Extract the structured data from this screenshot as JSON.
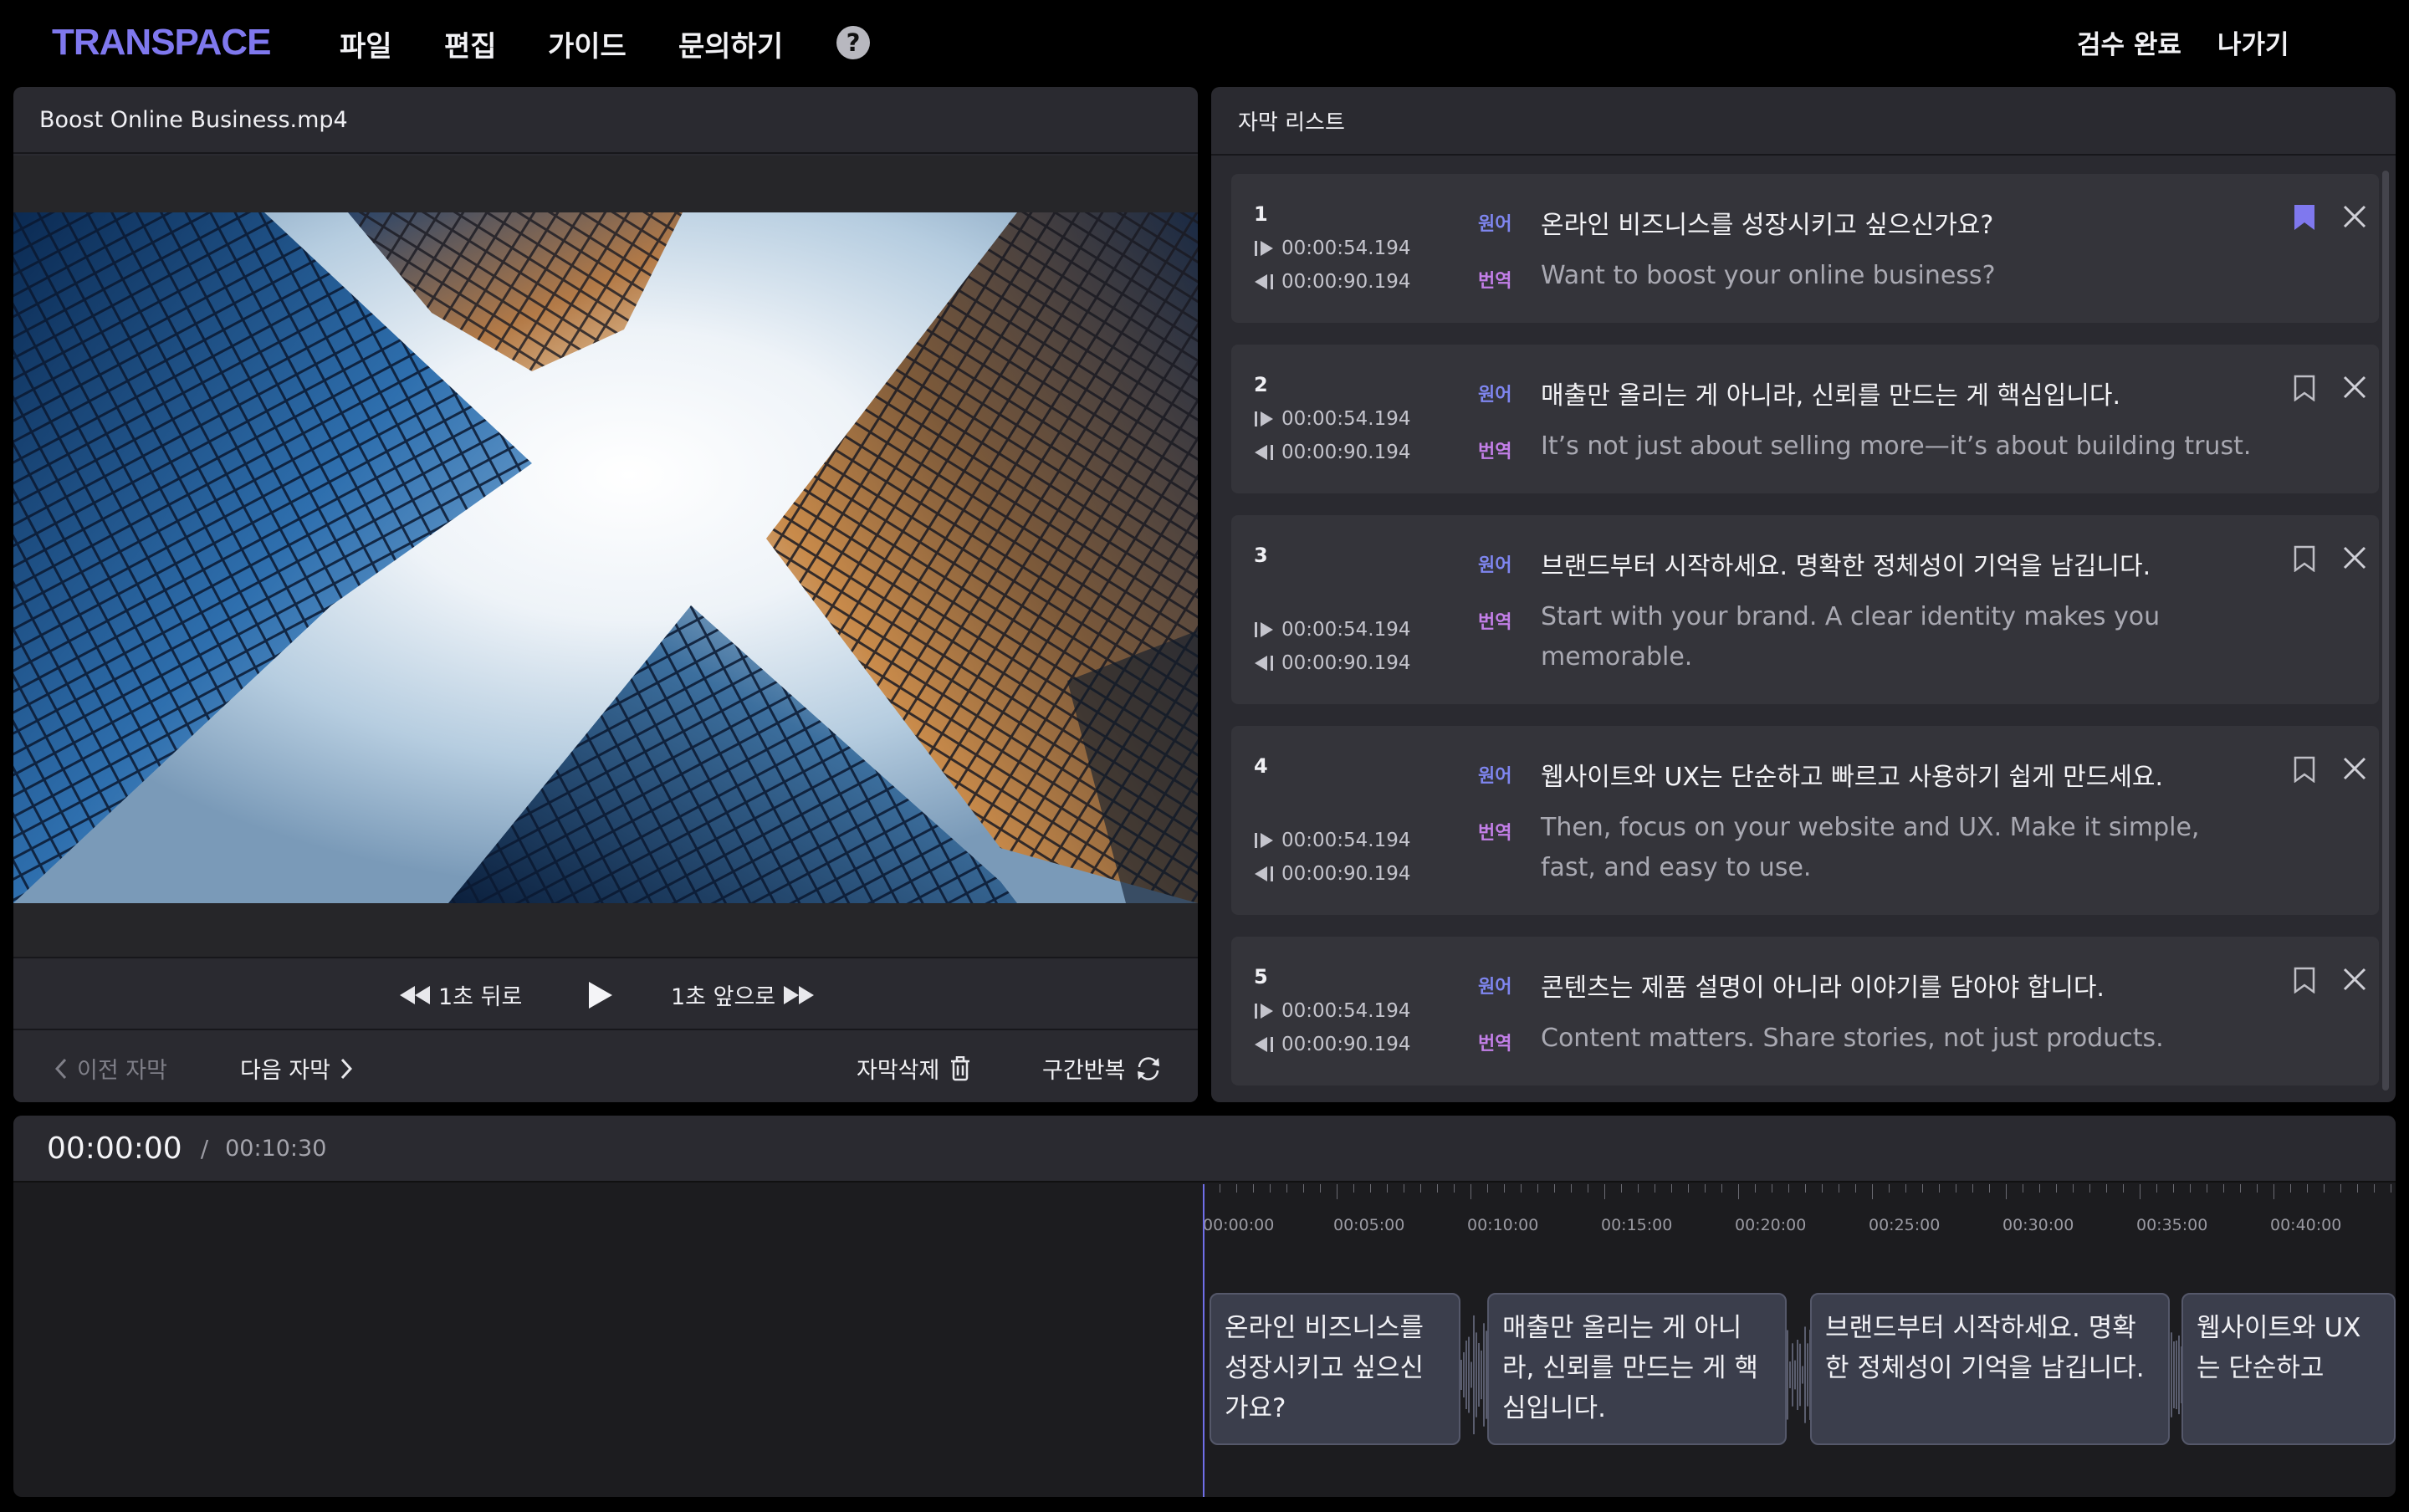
{
  "app": {
    "logo": "TRANSPACE",
    "menu": [
      "파일",
      "편집",
      "가이드",
      "문의하기"
    ],
    "help_glyph": "?",
    "review_done": "검수 완료",
    "exit": "나가기",
    "accent_color": "#7f78ee"
  },
  "video": {
    "filename": "Boost Online Business.mp4",
    "back_label": "1초 뒤로",
    "forward_label": "1초 앞으로",
    "prev_subtitle": "이전 자막",
    "next_subtitle": "다음 자막",
    "delete_subtitle": "자막삭제",
    "loop_section": "구간반복"
  },
  "subtitle_list": {
    "title": "자막 리스트",
    "source_tag": "원어",
    "translation_tag": "번역",
    "items": [
      {
        "index": "1",
        "start": "00:00:54.194",
        "end": "00:00:90.194",
        "source": "온라인 비즈니스를 성장시키고 싶으신가요?",
        "translation": "Want to boost your online business?",
        "bookmarked": true
      },
      {
        "index": "2",
        "start": "00:00:54.194",
        "end": "00:00:90.194",
        "source": "매출만 올리는 게 아니라, 신뢰를 만드는 게 핵심입니다.",
        "translation": "It’s not just about selling more—it’s about building trust.",
        "bookmarked": false
      },
      {
        "index": "3",
        "start": "00:00:54.194",
        "end": "00:00:90.194",
        "source": "브랜드부터 시작하세요. 명확한 정체성이 기억을 남깁니다.",
        "translation": "Start with your brand. A clear identity makes you memorable.",
        "bookmarked": false
      },
      {
        "index": "4",
        "start": "00:00:54.194",
        "end": "00:00:90.194",
        "source": "웹사이트와 UX는 단순하고 빠르고 사용하기 쉽게 만드세요.",
        "translation": "Then, focus on your website and UX. Make it simple, fast, and easy to use.",
        "bookmarked": false
      },
      {
        "index": "5",
        "start": "00:00:54.194",
        "end": "00:00:90.194",
        "source": "콘텐츠는 제품 설명이 아니라 이야기를 담아야 합니다.",
        "translation": "Content matters. Share stories, not just products.",
        "bookmarked": false
      }
    ]
  },
  "timeline": {
    "current": "00:00:00",
    "separator": "/",
    "total": "00:10:30",
    "ticks": [
      "00:00:00",
      "00:05:00",
      "00:10:00",
      "00:15:00",
      "00:20:00",
      "00:25:00",
      "00:30:00",
      "00:35:00",
      "00:40:00"
    ],
    "segments": [
      "온라인 비즈니스를 성장시키고 싶으신가요?",
      "매출만 올리는 게 아니라, 신뢰를 만드는 게 핵심입니다.",
      "브랜드부터 시작하세요. 명확한 정체성이 기억을 남깁니다.",
      "웹사이트와 UX는 단순하고"
    ]
  }
}
